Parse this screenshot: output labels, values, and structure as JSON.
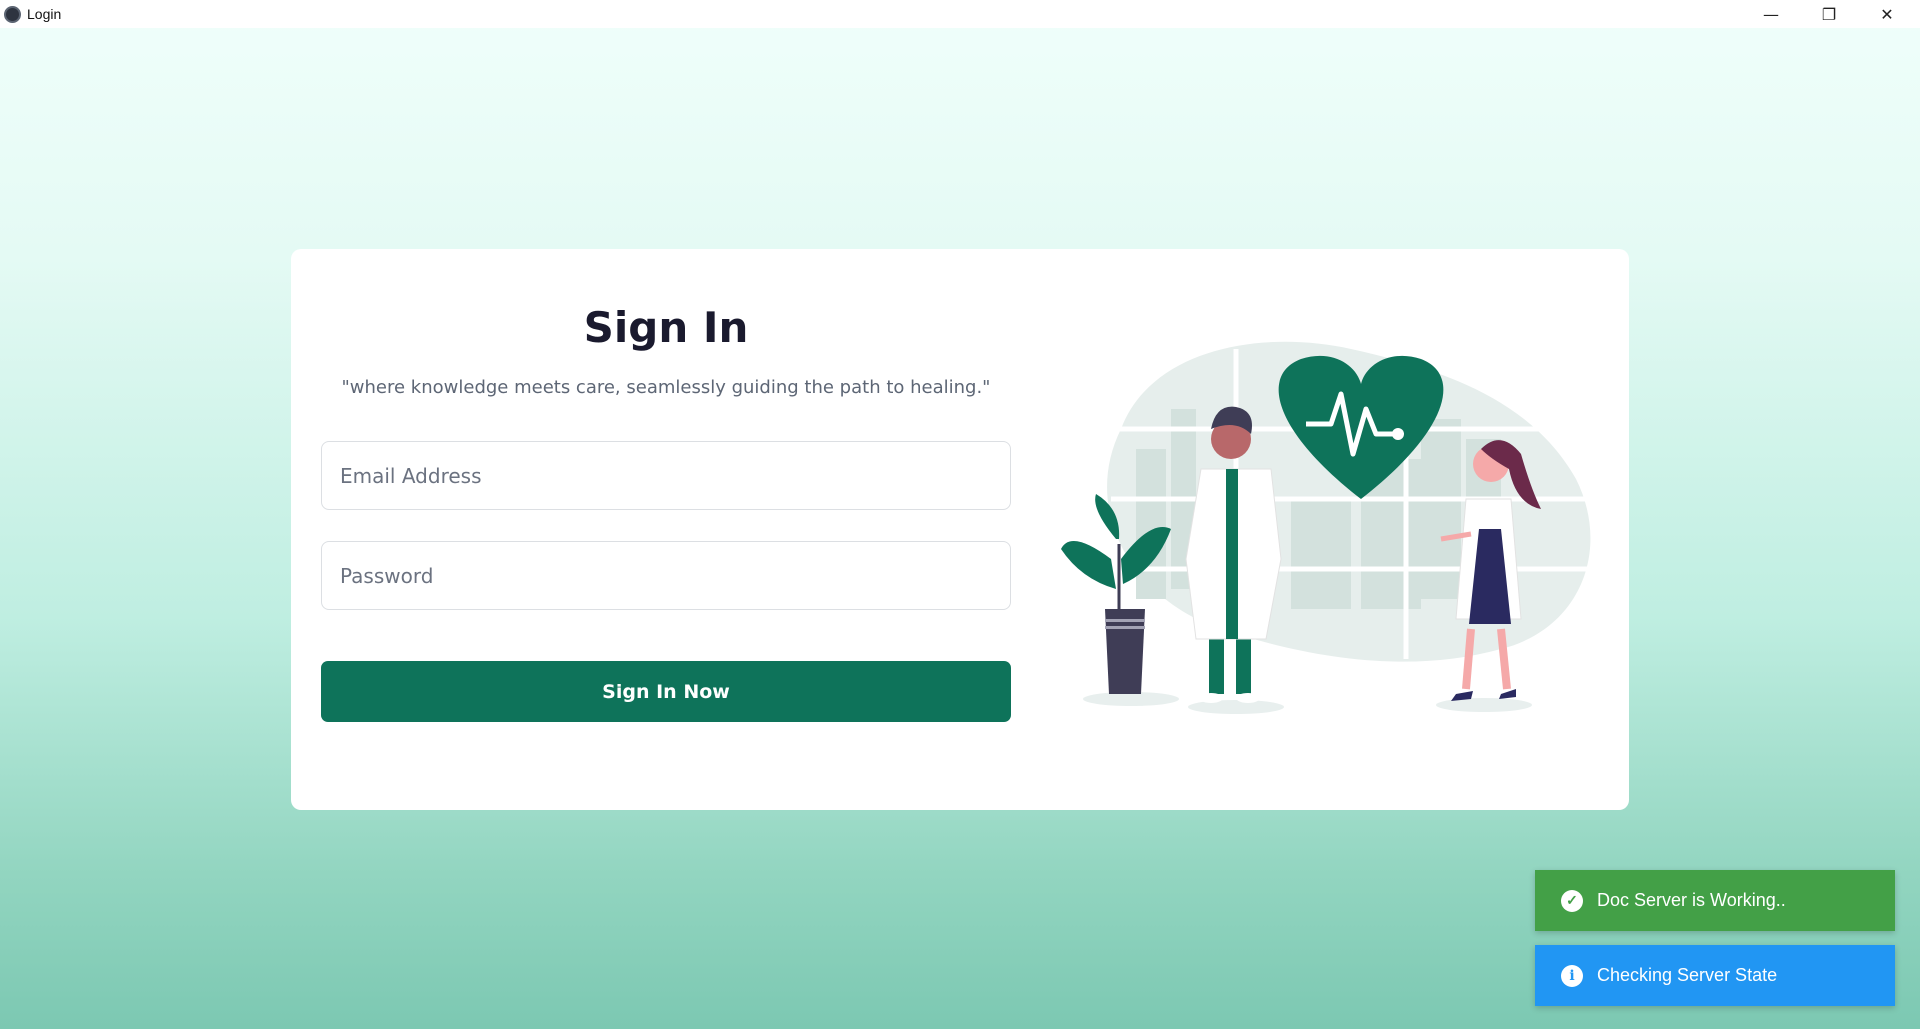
{
  "window": {
    "title": "Login",
    "controls": {
      "minimize": "—",
      "maximize": "❐",
      "close": "✕"
    }
  },
  "login": {
    "title": "Sign In",
    "tagline": "\"where knowledge meets care, seamlessly guiding the path to healing.\"",
    "email_placeholder": "Email Address",
    "password_placeholder": "Password",
    "submit_label": "Sign In Now"
  },
  "toasts": [
    {
      "type": "success",
      "icon": "check-circle-icon",
      "glyph": "✓",
      "message": "Doc Server is Working..",
      "color": "#43a047"
    },
    {
      "type": "info",
      "icon": "info-icon",
      "glyph": "i",
      "message": "Checking Server State",
      "color": "#2196f3"
    }
  ],
  "colors": {
    "accent": "#0e735a",
    "success": "#43a047",
    "info": "#2196f3"
  }
}
